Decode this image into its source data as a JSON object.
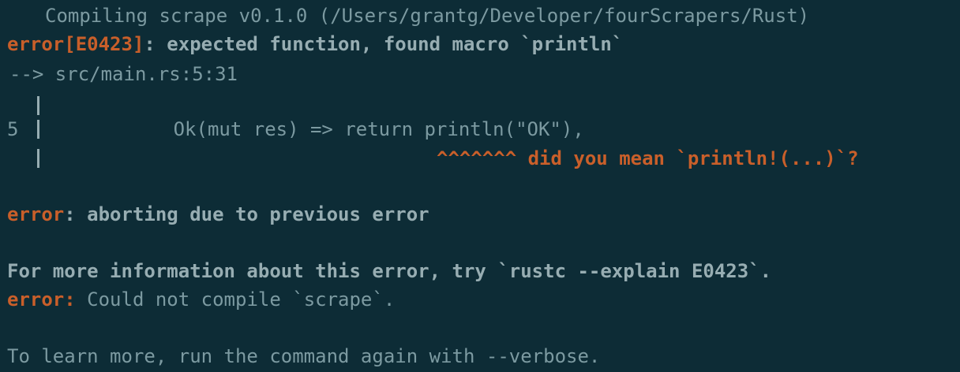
{
  "terminal": {
    "compiling": {
      "keyword": "Compiling",
      "text": " scrape v0.1.0 (/Users/grantg/Developer/fourScrapers/Rust)"
    },
    "error1": {
      "label": "error[E0423]",
      "message": ": expected function, found macro `println`"
    },
    "location": {
      "arrow": "-->",
      "path": " src/main.rs:5:31"
    },
    "snippet": {
      "line_number": "5",
      "code": "        Ok(mut res) => return println(\"OK\"),",
      "carets": "^^^^^^^",
      "hint": " did you mean `println!(...)`?"
    },
    "error2": {
      "label": "error",
      "message": ": aborting due to previous error"
    },
    "more_info": "For more information about this error, try `rustc --explain E0423`.",
    "error3": {
      "label": "error:",
      "message": " Could not compile `scrape`."
    },
    "learn_more": "To learn more, run the command again with --verbose."
  },
  "colors": {
    "background": "#0d2c36",
    "error": "#c95f2a",
    "text": "#97adb2",
    "dim": "#7c9aa1"
  }
}
